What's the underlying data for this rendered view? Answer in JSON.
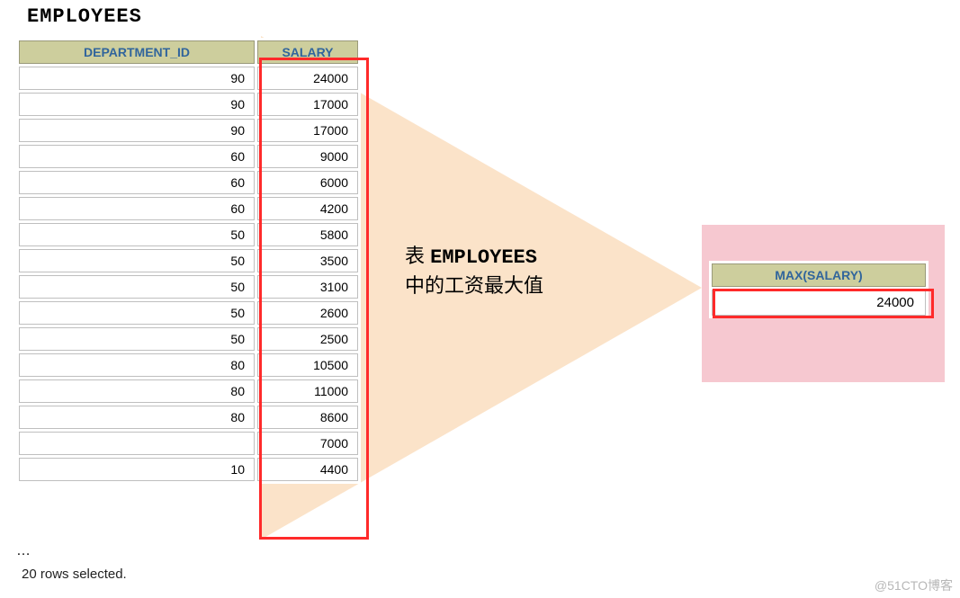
{
  "title": "EMPLOYEES",
  "columns": {
    "dept": "DEPARTMENT_ID",
    "sal": "SALARY"
  },
  "rows": [
    {
      "dept": "90",
      "sal": "24000"
    },
    {
      "dept": "90",
      "sal": "17000"
    },
    {
      "dept": "90",
      "sal": "17000"
    },
    {
      "dept": "60",
      "sal": "9000"
    },
    {
      "dept": "60",
      "sal": "6000"
    },
    {
      "dept": "60",
      "sal": "4200"
    },
    {
      "dept": "50",
      "sal": "5800"
    },
    {
      "dept": "50",
      "sal": "3500"
    },
    {
      "dept": "50",
      "sal": "3100"
    },
    {
      "dept": "50",
      "sal": "2600"
    },
    {
      "dept": "50",
      "sal": "2500"
    },
    {
      "dept": "80",
      "sal": "10500"
    },
    {
      "dept": "80",
      "sal": "11000"
    },
    {
      "dept": "80",
      "sal": "8600"
    },
    {
      "dept": "",
      "sal": "7000"
    },
    {
      "dept": "10",
      "sal": "4400"
    }
  ],
  "ellipsis": "…",
  "footer": "20 rows selected.",
  "label": {
    "line1_pre": "表 ",
    "line1_code": "EMPLOYEES",
    "line2": "中的工资最大值"
  },
  "result": {
    "header": "MAX(SALARY)",
    "value": "24000"
  },
  "watermark": "@51CTO博客"
}
